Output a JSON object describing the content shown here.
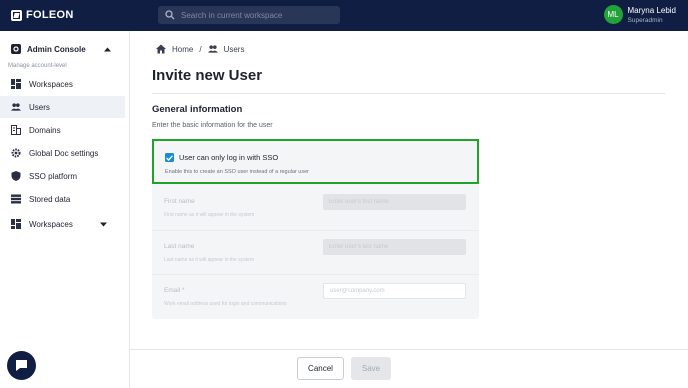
{
  "topbar": {
    "logo": "FOLEON",
    "search_placeholder": "Search in current workspace",
    "user": {
      "initials": "ML",
      "name": "Maryna Lebid",
      "role": "Superadmin"
    }
  },
  "sidebar": {
    "console_title": "Admin Console",
    "scope_label": "Manage account-level",
    "items": [
      {
        "label": "Workspaces",
        "icon": "dashboard-icon"
      },
      {
        "label": "Users",
        "icon": "users-icon",
        "active": true
      },
      {
        "label": "Domains",
        "icon": "domains-icon"
      },
      {
        "label": "Global Doc settings",
        "icon": "gear-icon"
      },
      {
        "label": "SSO platform",
        "icon": "shield-icon"
      },
      {
        "label": "Stored data",
        "icon": "storage-icon"
      }
    ],
    "workspaces_dropdown": "Workspaces"
  },
  "breadcrumb": {
    "home": "Home",
    "separator": "/",
    "current": "Users"
  },
  "page": {
    "title": "Invite new User",
    "section_title": "General information",
    "section_subtitle": "Enter the basic information for the user"
  },
  "sso": {
    "label": "User can only log in with SSO",
    "help": "Enable this to create an SSO user instead of a regular user",
    "checked": true
  },
  "fields": {
    "first_name": {
      "label": "First name",
      "help": "First name as it will appear in the system",
      "placeholder": "Enter user's first name"
    },
    "last_name": {
      "label": "Last name",
      "help": "Last name as it will appear in the system",
      "placeholder": "Enter user's last name"
    },
    "email": {
      "label": "Email *",
      "help": "Work email address used for login and communications",
      "placeholder": "user@company.com"
    }
  },
  "footer": {
    "cancel": "Cancel",
    "save": "Save"
  },
  "colors": {
    "topbar": "#0f1e42",
    "accent_green": "#21a32b",
    "checkbox_blue": "#1a8bd6"
  }
}
